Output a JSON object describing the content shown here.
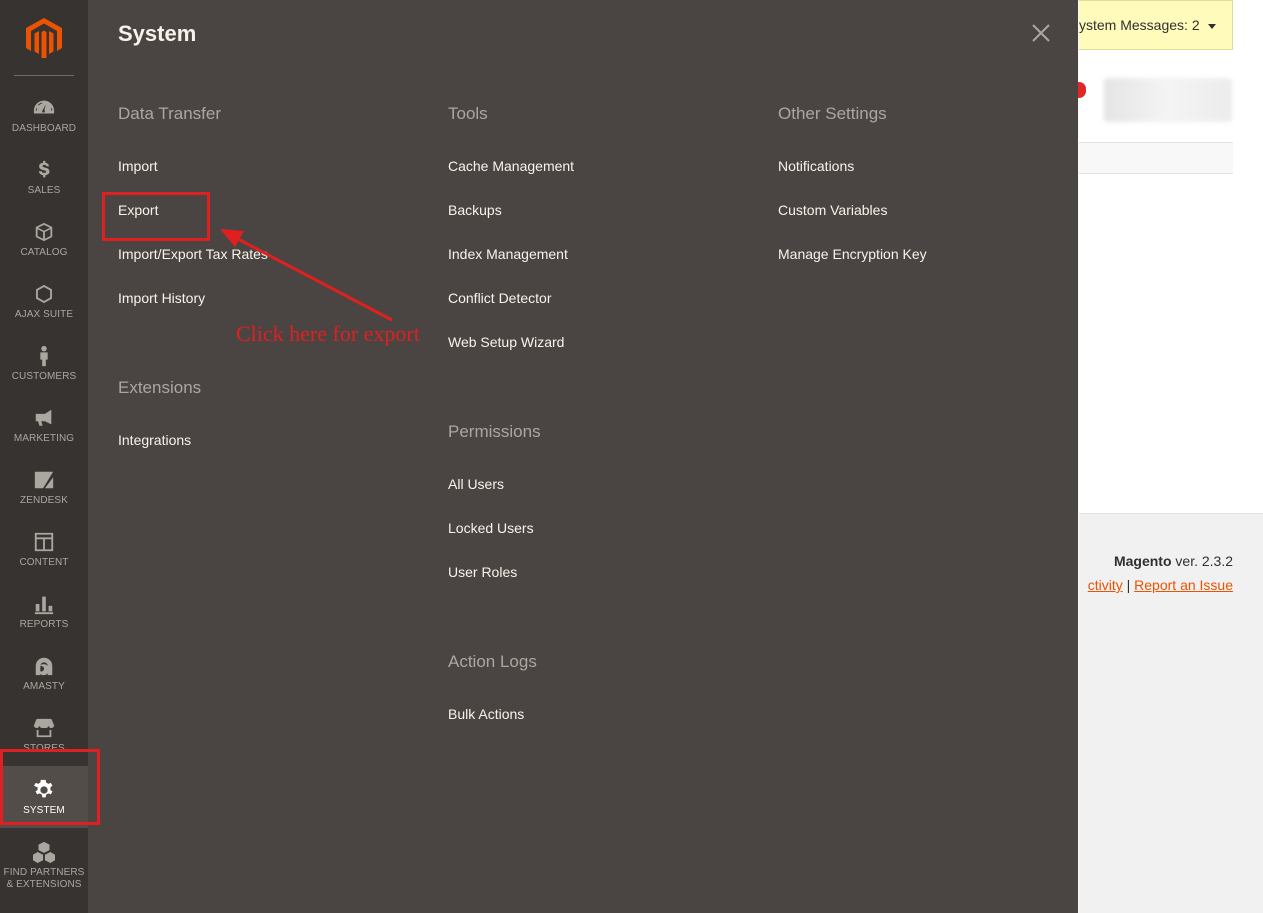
{
  "sidebar": {
    "items": [
      {
        "label": "DASHBOARD",
        "icon": "dashboard-icon"
      },
      {
        "label": "SALES",
        "icon": "dollar-icon"
      },
      {
        "label": "CATALOG",
        "icon": "cube-icon"
      },
      {
        "label": "AJAX SUITE",
        "icon": "hexagon-icon"
      },
      {
        "label": "CUSTOMERS",
        "icon": "person-icon"
      },
      {
        "label": "MARKETING",
        "icon": "megaphone-icon"
      },
      {
        "label": "ZENDESK",
        "icon": "zendesk-icon"
      },
      {
        "label": "CONTENT",
        "icon": "layout-icon"
      },
      {
        "label": "REPORTS",
        "icon": "bar-chart-icon"
      },
      {
        "label": "AMASTY",
        "icon": "amasty-icon"
      },
      {
        "label": "STORES",
        "icon": "storefront-icon"
      },
      {
        "label": "SYSTEM",
        "icon": "gear-icon"
      },
      {
        "label": "FIND PARTNERS\n& EXTENSIONS",
        "icon": "boxes-icon"
      }
    ],
    "active": "SYSTEM"
  },
  "panel": {
    "title": "System",
    "groups": {
      "data_transfer": {
        "title": "Data Transfer",
        "links": [
          "Import",
          "Export",
          "Import/Export Tax Rates",
          "Import History"
        ]
      },
      "extensions": {
        "title": "Extensions",
        "links": [
          "Integrations"
        ]
      },
      "tools": {
        "title": "Tools",
        "links": [
          "Cache Management",
          "Backups",
          "Index Management",
          "Conflict Detector",
          "Web Setup Wizard"
        ]
      },
      "permissions": {
        "title": "Permissions",
        "links": [
          "All Users",
          "Locked Users",
          "User Roles"
        ]
      },
      "action_logs": {
        "title": "Action Logs",
        "links": [
          "Bulk Actions"
        ]
      },
      "other_settings": {
        "title": "Other Settings",
        "links": [
          "Notifications",
          "Custom Variables",
          "Manage Encryption Key"
        ]
      }
    }
  },
  "background": {
    "system_messages": "ystem Messages: 2",
    "footer_brand": "Magento",
    "footer_version": " ver. 2.3.2",
    "footer_link_activity": "ctivity",
    "footer_separator": " | ",
    "footer_link_report": "Report an Issue"
  },
  "annotation": {
    "text": "Click here for export",
    "color": "#e02020"
  },
  "colors": {
    "sidebar_bg": "#373330",
    "panel_bg": "#4a4542",
    "accent": "#eb5202"
  }
}
